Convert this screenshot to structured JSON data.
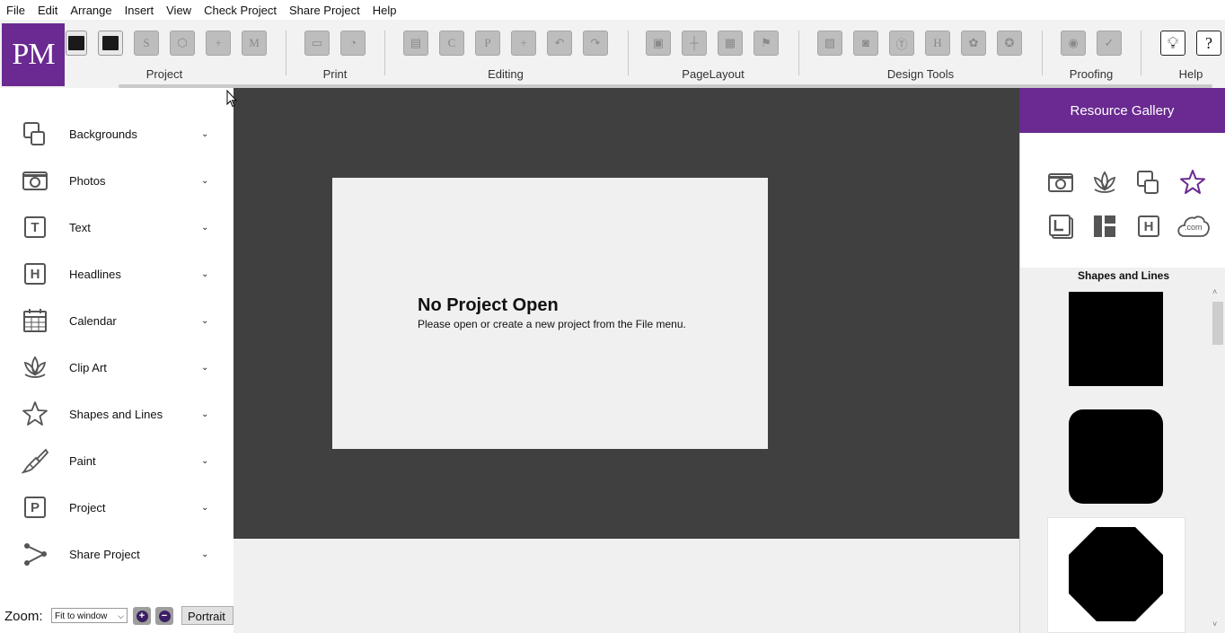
{
  "menu": [
    "File",
    "Edit",
    "Arrange",
    "Insert",
    "View",
    "Check Project",
    "Share Project",
    "Help"
  ],
  "logo": "PM",
  "ribbon": {
    "groups": [
      "Project",
      "Print",
      "Editing",
      "PageLayout",
      "Design Tools",
      "Proofing",
      "Help"
    ],
    "glyphs": {
      "project_s": "S",
      "project_m": "M",
      "editing_c": "C",
      "editing_p": "P",
      "design_h": "H",
      "help_q": "?"
    }
  },
  "left_panel": {
    "items": [
      {
        "label": "Backgrounds",
        "icon": "backgrounds-icon"
      },
      {
        "label": "Photos",
        "icon": "camera-icon"
      },
      {
        "label": "Text",
        "icon": "text-icon",
        "glyph": "T"
      },
      {
        "label": "Headlines",
        "icon": "headline-icon",
        "glyph": "H"
      },
      {
        "label": "Calendar",
        "icon": "calendar-icon"
      },
      {
        "label": "Clip Art",
        "icon": "lotus-icon"
      },
      {
        "label": "Shapes and Lines",
        "icon": "star-icon"
      },
      {
        "label": "Paint",
        "icon": "paintbrush-icon"
      },
      {
        "label": "Project",
        "icon": "project-icon",
        "glyph": "P"
      },
      {
        "label": "Share Project",
        "icon": "share-icon"
      }
    ],
    "chevron": "⌄"
  },
  "zoom": {
    "label": "Zoom:",
    "select_value": "Fit to window",
    "zoom_in": "+",
    "zoom_out": "−",
    "orientation": "Portrait"
  },
  "canvas": {
    "title": "No Project Open",
    "message": "Please open or create a new project from the File menu."
  },
  "gallery": {
    "header": "Resource Gallery",
    "section_title": "Shapes and Lines",
    "icon_h": "H",
    "icon_com": ".com",
    "accent": "#6a2a91"
  }
}
